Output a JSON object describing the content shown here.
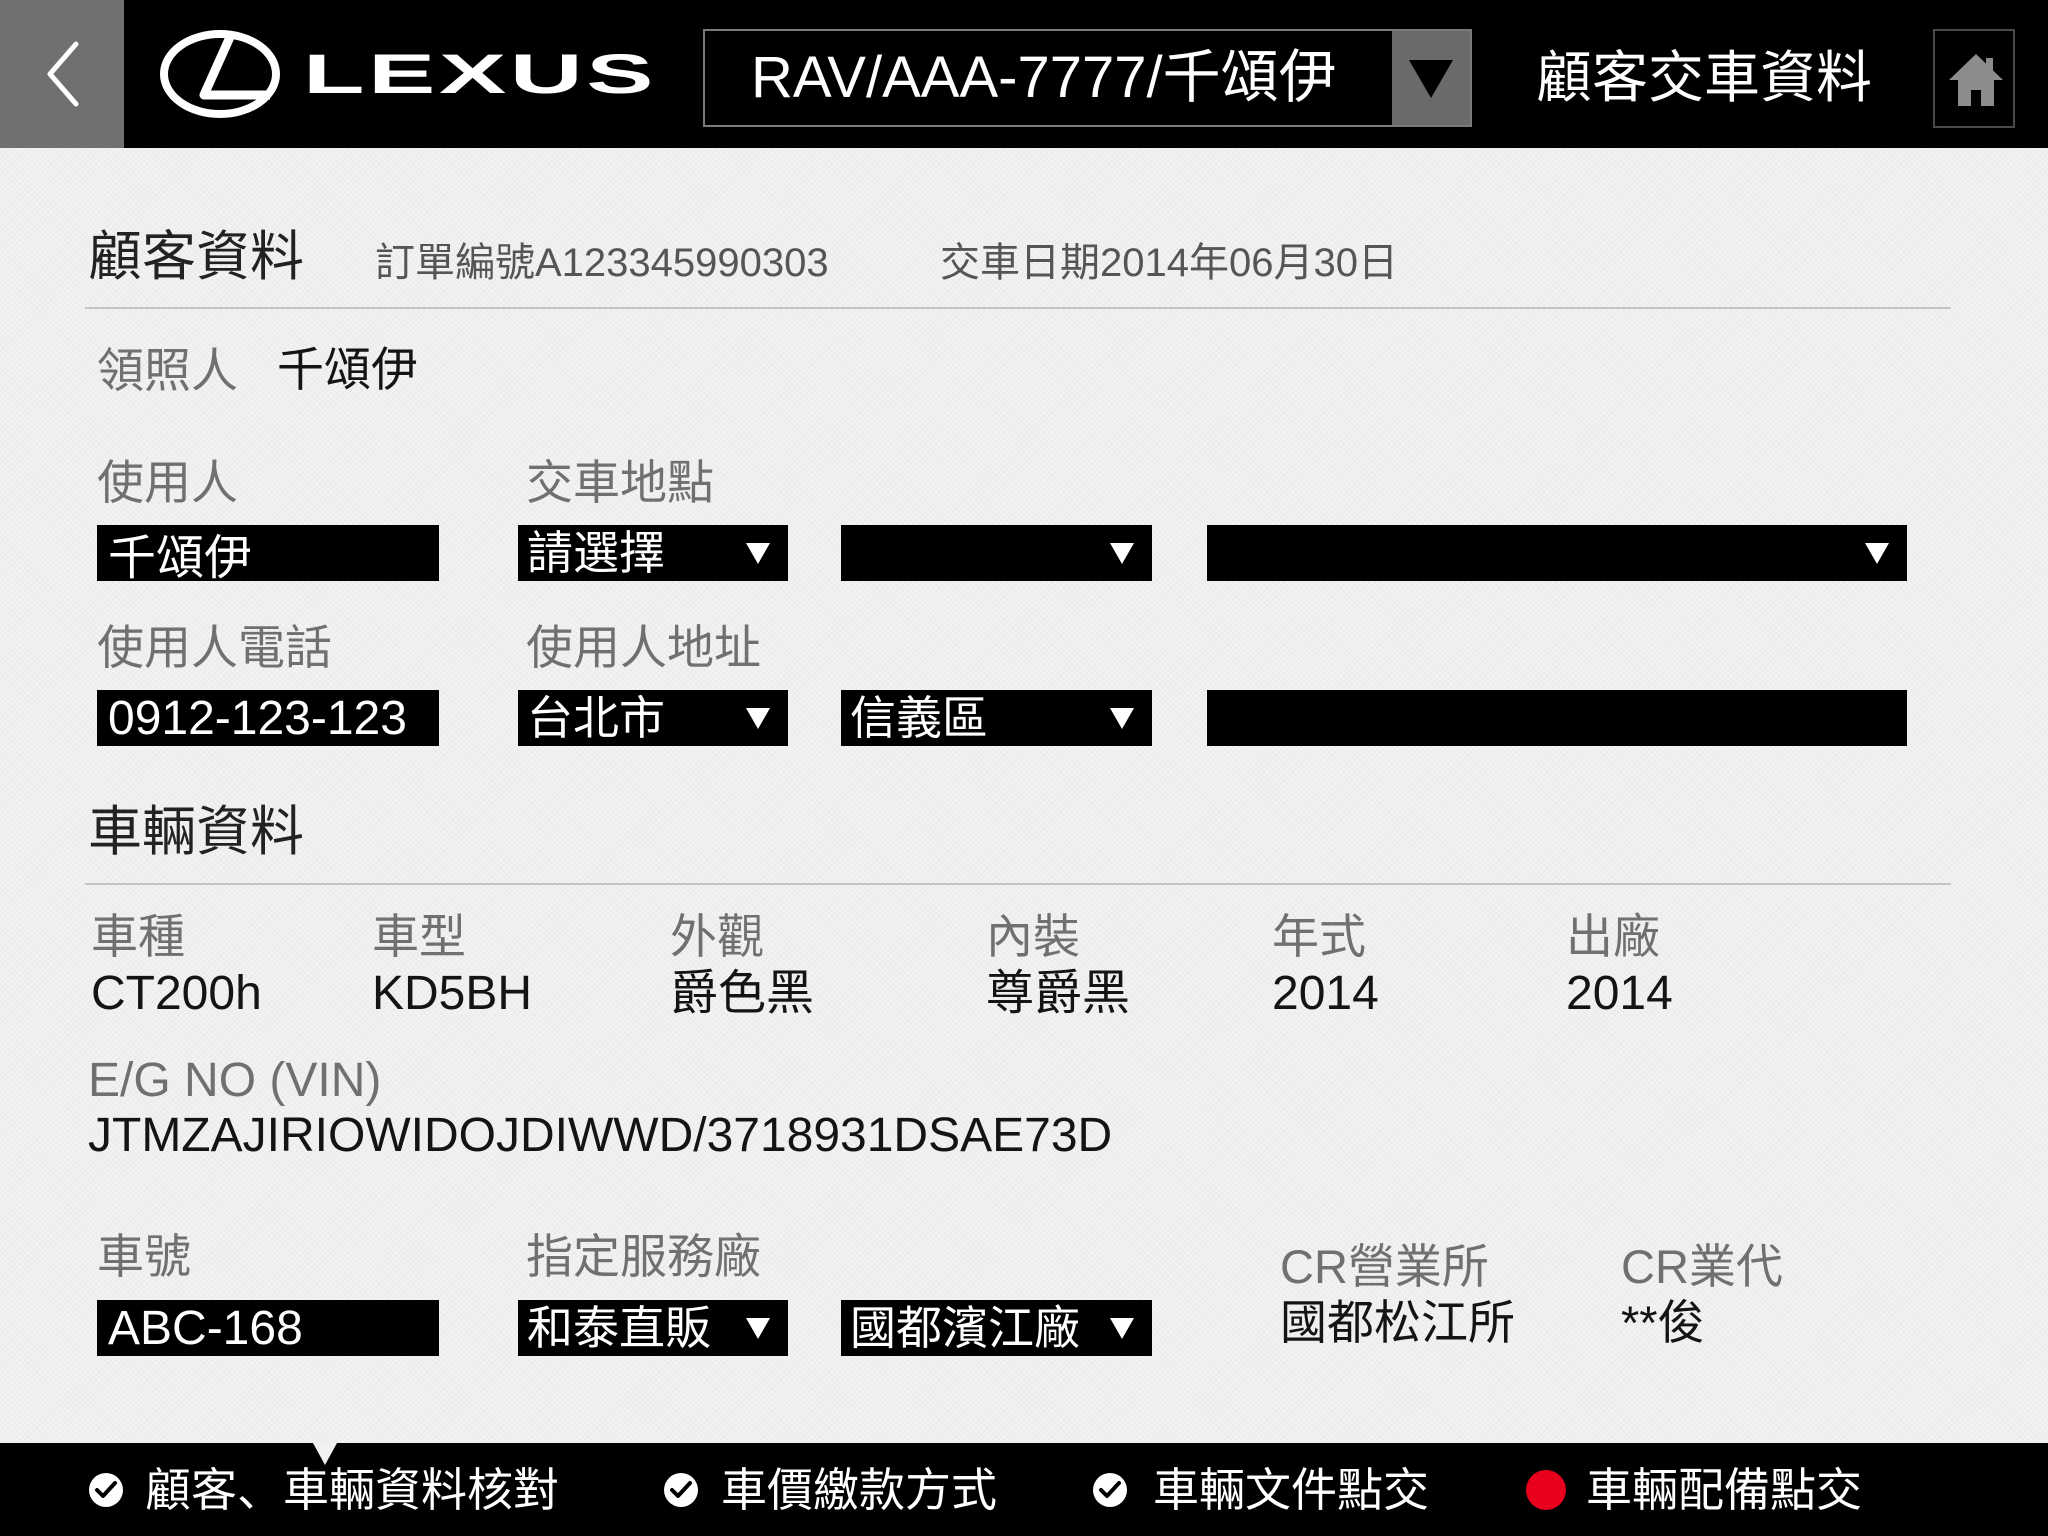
{
  "header": {
    "back_icon": "chevron-left-icon",
    "brand_emblem_icon": "lexus-emblem-icon",
    "brand_wordmark": "LEXUS",
    "vehicle_selector": {
      "value": "RAV/AAA-7777/千頌伊",
      "icon": "triangle-down-icon"
    },
    "title": "顧客交車資料",
    "home_icon": "home-icon"
  },
  "customer": {
    "section_title": "顧客資料",
    "order_number": "訂單編號A123345990303",
    "delivery_date": "交車日期2014年06月30日",
    "licensee": {
      "label": "領照人",
      "value": "千頌伊"
    },
    "user": {
      "label": "使用人",
      "value": "千頌伊"
    },
    "delivery_location": {
      "label": "交車地點",
      "selects": [
        "請選擇",
        "",
        ""
      ]
    },
    "phone": {
      "label": "使用人電話",
      "value": "0912-123-123"
    },
    "address": {
      "label": "使用人地址",
      "city": "台北市",
      "district": "信義區",
      "detail": ""
    }
  },
  "vehicle": {
    "section_title": "車輛資料",
    "fields": [
      {
        "label": "車種",
        "value": "CT200h"
      },
      {
        "label": "車型",
        "value": "KD5BH"
      },
      {
        "label": "外觀",
        "value": "爵色黑"
      },
      {
        "label": "內裝",
        "value": "尊爵黑"
      },
      {
        "label": "年式",
        "value": "2014"
      },
      {
        "label": "出廠",
        "value": "2014"
      }
    ],
    "vin": {
      "label": "E/G NO (VIN)",
      "value": "JTMZAJIRIOWIDOJDIWWD/3718931DSAE73D"
    },
    "plate": {
      "label": "車號",
      "value": "ABC-168"
    },
    "service_center": {
      "label": "指定服務廠",
      "selects": [
        "和泰直販",
        "國都濱江廠"
      ]
    },
    "cr_office": {
      "label": "CR營業所",
      "value": "國都松江所"
    },
    "cr_agent": {
      "label": "CR業代",
      "value": "**俊"
    }
  },
  "progress_steps": [
    {
      "label": "顧客、車輛資料核對",
      "icon": "check-circle-icon",
      "active": true
    },
    {
      "label": "車價繳款方式",
      "icon": "check-circle-icon"
    },
    {
      "label": "車輛文件點交",
      "icon": "check-circle-icon"
    },
    {
      "label": "車輛配備點交",
      "icon": "red-dot-icon"
    }
  ],
  "colors": {
    "top_bar": "#000000",
    "back_button": "#707070",
    "input_background": "#000000",
    "page_background": "#f2f2f2",
    "pending_dot": "#e8001c"
  }
}
